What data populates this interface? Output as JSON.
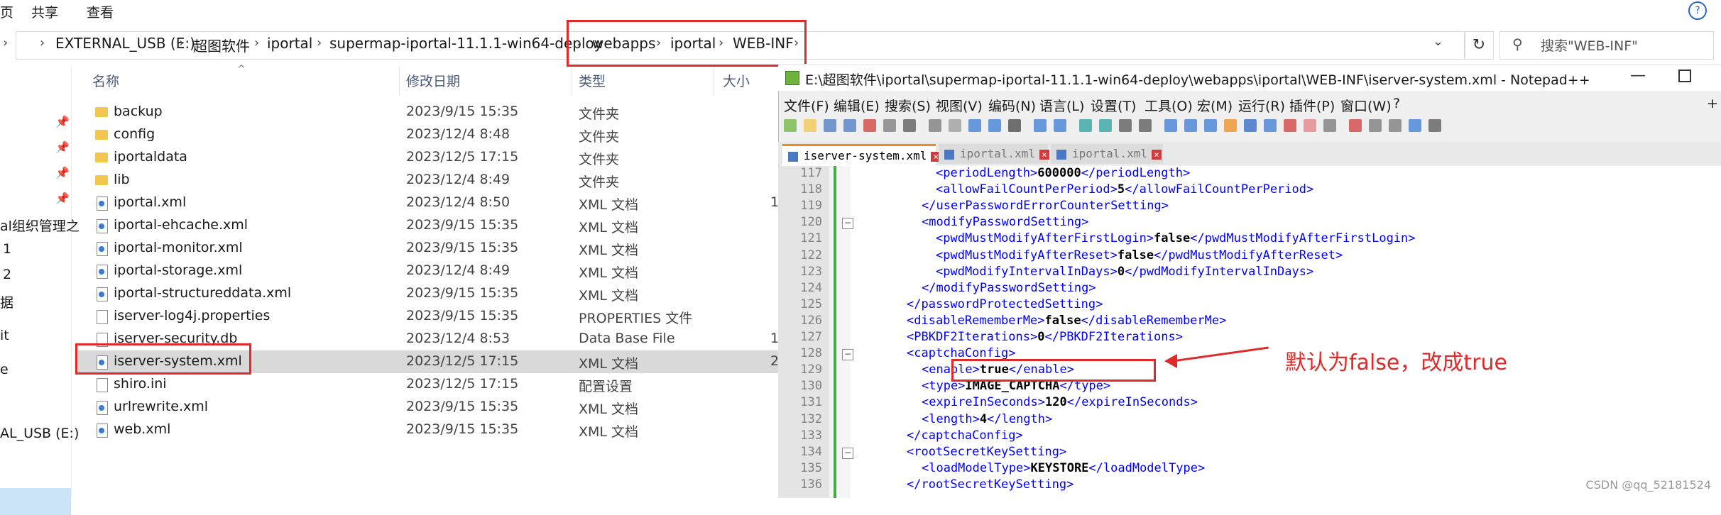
{
  "ribbon": {
    "tabs": [
      "页",
      "共享",
      "查看"
    ]
  },
  "address": {
    "crumbs": [
      "EXTERNAL_USB (E:)",
      "超图软件",
      "iportal",
      "supermap-iportal-11.1.1-win64-deploy",
      "webapps",
      "iportal",
      "WEB-INF"
    ],
    "search_placeholder": "搜索\"WEB-INF\""
  },
  "nav": {
    "items": [
      "al组织管理之",
      "1",
      "2",
      "据",
      "it",
      "e",
      "AL_USB (E:)"
    ]
  },
  "columns": {
    "name": "名称",
    "date": "修改日期",
    "type": "类型",
    "size": "大小"
  },
  "files": [
    {
      "name": "backup",
      "date": "2023/9/15 15:35",
      "type": "文件夹",
      "size": "",
      "kind": "folder"
    },
    {
      "name": "config",
      "date": "2023/12/4 8:48",
      "type": "文件夹",
      "size": "",
      "kind": "folder"
    },
    {
      "name": "iportaldata",
      "date": "2023/12/5 17:15",
      "type": "文件夹",
      "size": "",
      "kind": "folder"
    },
    {
      "name": "lib",
      "date": "2023/12/4 8:49",
      "type": "文件夹",
      "size": "",
      "kind": "folder"
    },
    {
      "name": "iportal.xml",
      "date": "2023/12/4 8:50",
      "type": "XML 文档",
      "size": "1",
      "kind": "xml"
    },
    {
      "name": "iportal-ehcache.xml",
      "date": "2023/9/15 15:35",
      "type": "XML 文档",
      "size": "",
      "kind": "xml"
    },
    {
      "name": "iportal-monitor.xml",
      "date": "2023/9/15 15:35",
      "type": "XML 文档",
      "size": "",
      "kind": "xml"
    },
    {
      "name": "iportal-storage.xml",
      "date": "2023/12/4 8:49",
      "type": "XML 文档",
      "size": "",
      "kind": "xml"
    },
    {
      "name": "iportal-structureddata.xml",
      "date": "2023/9/15 15:35",
      "type": "XML 文档",
      "size": "",
      "kind": "xml"
    },
    {
      "name": "iserver-log4j.properties",
      "date": "2023/9/15 15:35",
      "type": "PROPERTIES 文件",
      "size": "",
      "kind": "file"
    },
    {
      "name": "iserver-security.db",
      "date": "2023/12/4 8:53",
      "type": "Data Base File",
      "size": "1(",
      "kind": "file"
    },
    {
      "name": "iserver-system.xml",
      "date": "2023/12/5 17:15",
      "type": "XML 文档",
      "size": "2",
      "kind": "xml"
    },
    {
      "name": "shiro.ini",
      "date": "2023/12/5 17:15",
      "type": "配置设置",
      "size": "",
      "kind": "file"
    },
    {
      "name": "urlrewrite.xml",
      "date": "2023/9/15 15:35",
      "type": "XML 文档",
      "size": "",
      "kind": "xml"
    },
    {
      "name": "web.xml",
      "date": "2023/9/15 15:35",
      "type": "XML 文档",
      "size": "",
      "kind": "xml"
    }
  ],
  "npp": {
    "title": "E:\\超图软件\\iportal\\supermap-iportal-11.1.1-win64-deploy\\webapps\\iportal\\WEB-INF\\iserver-system.xml - Notepad++",
    "menu": [
      "文件(F)",
      "编辑(E)",
      "搜索(S)",
      "视图(V)",
      "编码(N)",
      "语言(L)",
      "设置(T)",
      "工具(O)",
      "宏(M)",
      "运行(R)",
      "插件(P)",
      "窗口(W)",
      "?",
      "+"
    ],
    "tabs": [
      "iserver-system.xml",
      "iportal.xml",
      "iportal.xml"
    ],
    "lines": [
      {
        "n": "117",
        "indent": 11,
        "open": "<periodLength>",
        "val": "600000",
        "close": "</periodLength>"
      },
      {
        "n": "118",
        "indent": 11,
        "open": "<allowFailCountPerPeriod>",
        "val": "5",
        "close": "</allowFailCountPerPeriod>"
      },
      {
        "n": "119",
        "indent": 9,
        "open": "</userPasswordErrorCounterSetting>",
        "val": "",
        "close": ""
      },
      {
        "n": "120",
        "indent": 9,
        "open": "<modifyPasswordSetting>",
        "val": "",
        "close": ""
      },
      {
        "n": "121",
        "indent": 11,
        "open": "<pwdMustModifyAfterFirstLogin>",
        "val": "false",
        "close": "</pwdMustModifyAfterFirstLogin>"
      },
      {
        "n": "122",
        "indent": 11,
        "open": "<pwdMustModifyAfterReset>",
        "val": "false",
        "close": "</pwdMustModifyAfterReset>"
      },
      {
        "n": "123",
        "indent": 11,
        "open": "<pwdModifyIntervalInDays>",
        "val": "0",
        "close": "</pwdModifyIntervalInDays>"
      },
      {
        "n": "124",
        "indent": 9,
        "open": "</modifyPasswordSetting>",
        "val": "",
        "close": ""
      },
      {
        "n": "125",
        "indent": 7,
        "open": "</passwordProtectedSetting>",
        "val": "",
        "close": ""
      },
      {
        "n": "126",
        "indent": 7,
        "open": "<disableRememberMe>",
        "val": "false",
        "close": "</disableRememberMe>"
      },
      {
        "n": "127",
        "indent": 7,
        "open": "<PBKDF2Iterations>",
        "val": "0",
        "close": "</PBKDF2Iterations>"
      },
      {
        "n": "128",
        "indent": 7,
        "open": "<captchaConfig>",
        "val": "",
        "close": ""
      },
      {
        "n": "129",
        "indent": 9,
        "open": "<enable>",
        "val": "true",
        "close": "</enable>"
      },
      {
        "n": "130",
        "indent": 9,
        "open": "<type>",
        "val": "IMAGE_CAPTCHA",
        "close": "</type>"
      },
      {
        "n": "131",
        "indent": 9,
        "open": "<expireInSeconds>",
        "val": "120",
        "close": "</expireInSeconds>"
      },
      {
        "n": "132",
        "indent": 9,
        "open": "<length>",
        "val": "4",
        "close": "</length>"
      },
      {
        "n": "133",
        "indent": 7,
        "open": "</captchaConfig>",
        "val": "",
        "close": ""
      },
      {
        "n": "134",
        "indent": 7,
        "open": "<rootSecretKeySetting>",
        "val": "",
        "close": ""
      },
      {
        "n": "135",
        "indent": 9,
        "open": "<loadModelType>",
        "val": "KEYSTORE",
        "close": "</loadModelType>"
      },
      {
        "n": "136",
        "indent": 7,
        "open": "</rootSecretKeySetting>",
        "val": "",
        "close": ""
      }
    ]
  },
  "annotation": "默认为false，改成true",
  "watermark": "CSDN @qq_52181524",
  "colors": {
    "annotation_red": "#e02a2a",
    "tag_blue": "#0000ff",
    "tab_accent": "#f08c1f"
  }
}
